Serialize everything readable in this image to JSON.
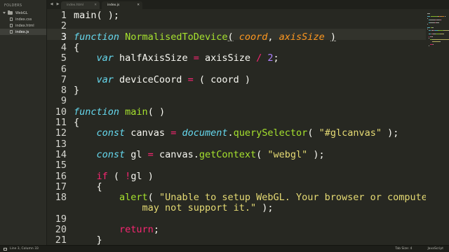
{
  "sidebar": {
    "header": "FOLDERS",
    "folder": {
      "name": "WebGL",
      "icon": "folder-icon"
    },
    "files": [
      {
        "name": "index.css",
        "active": false
      },
      {
        "name": "index.html",
        "active": false
      },
      {
        "name": "index.js",
        "active": true
      }
    ]
  },
  "tabs": [
    {
      "label": "index.html",
      "active": false
    },
    {
      "label": "index.js",
      "active": true
    }
  ],
  "editor": {
    "current_line": 3,
    "lines": [
      {
        "n": "1",
        "tokens": [
          [
            "",
            "main( );"
          ]
        ]
      },
      {
        "n": "2",
        "tokens": []
      },
      {
        "n": "3",
        "tokens": [
          [
            "kw",
            "function"
          ],
          [
            "",
            " "
          ],
          [
            "fn",
            "NormalisedToDevice"
          ],
          [
            "ul",
            "("
          ],
          [
            "",
            " "
          ],
          [
            "pa",
            "coord"
          ],
          [
            "",
            ", "
          ],
          [
            "pa",
            "axisSize"
          ],
          [
            "",
            " "
          ],
          [
            "ul",
            ")"
          ]
        ]
      },
      {
        "n": "4",
        "tokens": [
          [
            "",
            "{"
          ]
        ]
      },
      {
        "n": "5",
        "tokens": [
          [
            "",
            "    "
          ],
          [
            "kw",
            "var"
          ],
          [
            "",
            " halfAxisSize "
          ],
          [
            "st",
            "="
          ],
          [
            "",
            " axisSize "
          ],
          [
            "st",
            "/"
          ],
          [
            "",
            " "
          ],
          [
            "nu",
            "2"
          ],
          [
            "",
            ";"
          ]
        ]
      },
      {
        "n": "6",
        "tokens": []
      },
      {
        "n": "7",
        "tokens": [
          [
            "",
            "    "
          ],
          [
            "kw",
            "var"
          ],
          [
            "",
            " deviceCoord "
          ],
          [
            "st",
            "="
          ],
          [
            "",
            " ( coord )"
          ]
        ]
      },
      {
        "n": "8",
        "tokens": [
          [
            "",
            "}"
          ]
        ]
      },
      {
        "n": "9",
        "tokens": []
      },
      {
        "n": "10",
        "tokens": [
          [
            "kw",
            "function"
          ],
          [
            "",
            " "
          ],
          [
            "fn",
            "main"
          ],
          [
            "",
            "( )"
          ]
        ]
      },
      {
        "n": "11",
        "tokens": [
          [
            "",
            "{"
          ]
        ]
      },
      {
        "n": "12",
        "tokens": [
          [
            "",
            "    "
          ],
          [
            "kw",
            "const"
          ],
          [
            "",
            " canvas "
          ],
          [
            "st",
            "="
          ],
          [
            "",
            " "
          ],
          [
            "bi",
            "document"
          ],
          [
            "",
            "."
          ],
          [
            "fn",
            "querySelector"
          ],
          [
            "",
            "( "
          ],
          [
            "sr",
            "\"#glcanvas\""
          ],
          [
            "",
            " );"
          ]
        ]
      },
      {
        "n": "13",
        "tokens": []
      },
      {
        "n": "14",
        "tokens": [
          [
            "",
            "    "
          ],
          [
            "kw",
            "const"
          ],
          [
            "",
            " gl "
          ],
          [
            "st",
            "="
          ],
          [
            "",
            " canvas."
          ],
          [
            "fn",
            "getContext"
          ],
          [
            "",
            "( "
          ],
          [
            "sr",
            "\"webgl\""
          ],
          [
            "",
            " );"
          ]
        ]
      },
      {
        "n": "15",
        "tokens": []
      },
      {
        "n": "16",
        "tokens": [
          [
            "",
            "    "
          ],
          [
            "st",
            "if"
          ],
          [
            "",
            " ( "
          ],
          [
            "st",
            "!"
          ],
          [
            "",
            "gl )"
          ]
        ]
      },
      {
        "n": "17",
        "tokens": [
          [
            "",
            "    {"
          ]
        ]
      },
      {
        "n": "18",
        "tokens": [
          [
            "",
            "        "
          ],
          [
            "fn",
            "alert"
          ],
          [
            "",
            "( "
          ],
          [
            "sr",
            "\"Unable to setup WebGL. Your browser or computer"
          ]
        ]
      },
      {
        "n": "",
        "tokens": [
          [
            "",
            "            "
          ],
          [
            "sr",
            "may not support it.\""
          ],
          [
            "",
            " );"
          ]
        ]
      },
      {
        "n": "19",
        "tokens": []
      },
      {
        "n": "20",
        "tokens": [
          [
            "",
            "        "
          ],
          [
            "st",
            "return"
          ],
          [
            "",
            ";"
          ]
        ]
      },
      {
        "n": "21",
        "tokens": [
          [
            "",
            "    }"
          ]
        ]
      }
    ]
  },
  "status": {
    "position": "Line 3, Column 33",
    "tab_size": "Tab Size: 4",
    "syntax": "JavaScript"
  },
  "colors": {
    "background": "#272822",
    "keyword": "#66d9ef",
    "operator": "#f92672",
    "function": "#a6e22e",
    "parameter": "#fd971f",
    "number": "#ae81ff",
    "string": "#e6db74"
  }
}
